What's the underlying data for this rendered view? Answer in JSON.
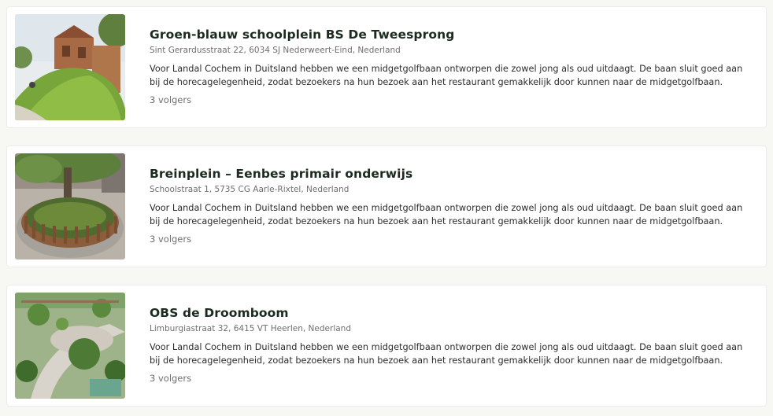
{
  "projects": [
    {
      "title": "Groen-blauw schoolplein BS De Tweesprong",
      "address": "Sint Gerardusstraat 22, 6034 SJ Nederweert-Eind, Nederland",
      "description": "Voor Landal Cochem in Duitsland hebben we een midgetgolfbaan ontworpen die zowel jong als oud uitdaagt. De baan sluit goed aan bij de horecagelegenheid, zodat bezoekers na hun bezoek aan het restaurant gemakkelijk door kunnen naar de midgetgolfbaan.",
      "followers": "3 volgers",
      "image_icon": "playground-photo"
    },
    {
      "title": "Breinplein – Eenbes primair onderwijs",
      "address": "Schoolstraat 1, 5735 CG Aarle-Rixtel, Nederland",
      "description": "Voor Landal Cochem in Duitsland hebben we een midgetgolfbaan ontworpen die zowel jong als oud uitdaagt. De baan sluit goed aan bij de horecagelegenheid, zodat bezoekers na hun bezoek aan het restaurant gemakkelijk door kunnen naar de midgetgolfbaan.",
      "followers": "3 volgers",
      "image_icon": "tree-planter-photo"
    },
    {
      "title": "OBS de Droomboom",
      "address": "Limburgiastraat 32, 6415 VT Heerlen, Nederland",
      "description": "Voor Landal Cochem in Duitsland hebben we een midgetgolfbaan ontworpen die zowel jong als oud uitdaagt. De baan sluit goed aan bij de horecagelegenheid, zodat bezoekers na hun bezoek aan het restaurant gemakkelijk door kunnen naar de midgetgolfbaan.",
      "followers": "3 volgers",
      "image_icon": "schoolyard-render-photo"
    }
  ]
}
